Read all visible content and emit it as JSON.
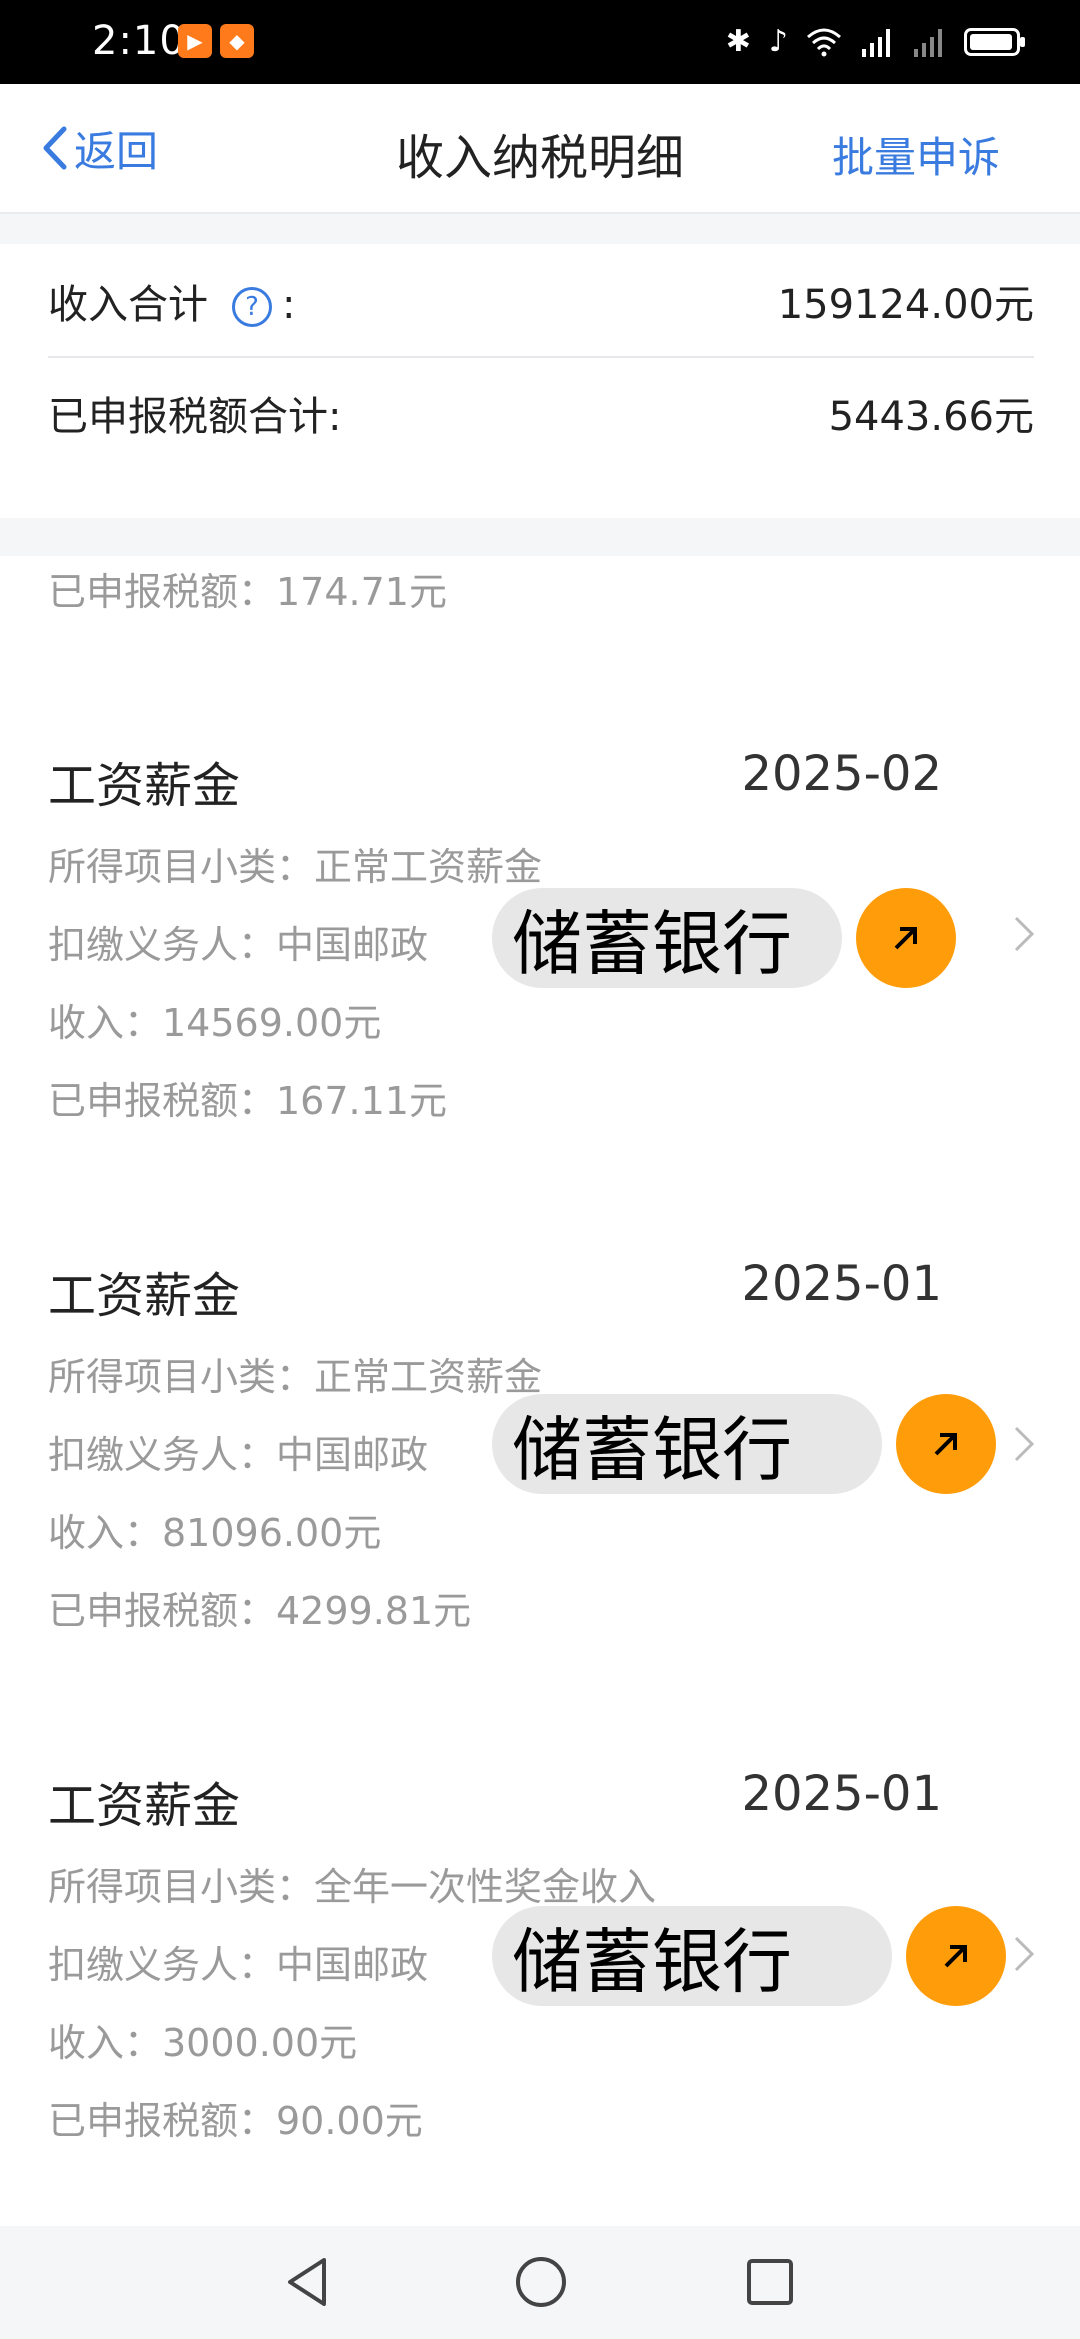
{
  "status_bar": {
    "time": "2:10",
    "icons": [
      "bluetooth-icon",
      "mute-icon",
      "wifi-icon",
      "signal-4g-icon",
      "signal-icon",
      "battery-icon"
    ]
  },
  "nav": {
    "back_label": "返回",
    "title": "收入纳税明细",
    "batch_appeal": "批量申诉"
  },
  "summary": {
    "income_total_label": "收入合计",
    "colon": ":",
    "income_total_value": "159124.00元",
    "tax_total_label": "已申报税额合计:",
    "tax_total_value": "5443.66元"
  },
  "partial_record": {
    "tax_line": "已申报税额：174.71元"
  },
  "records": [
    {
      "title": "工资薪金",
      "date": "2025-02",
      "subcategory": "所得项目小类：正常工资薪金",
      "withholder": "扣缴义务人：中国邮政",
      "income": "收入：14569.00元",
      "tax": "已申报税额：167.11元"
    },
    {
      "title": "工资薪金",
      "date": "2025-01",
      "subcategory": "所得项目小类：正常工资薪金",
      "withholder": "扣缴义务人：中国邮政",
      "income": "收入：81096.00元",
      "tax": "已申报税额：4299.81元"
    },
    {
      "title": "工资薪金",
      "date": "2025-01",
      "subcategory": "所得项目小类：全年一次性奖金收入",
      "withholder": "扣缴义务人：中国邮政",
      "income": "收入：3000.00元",
      "tax": "已申报税额：90.00元"
    }
  ],
  "overlay_label": "储蓄银行",
  "colors": {
    "accent": "#3a7be0",
    "overlay_orb": "#ff9c0a"
  }
}
